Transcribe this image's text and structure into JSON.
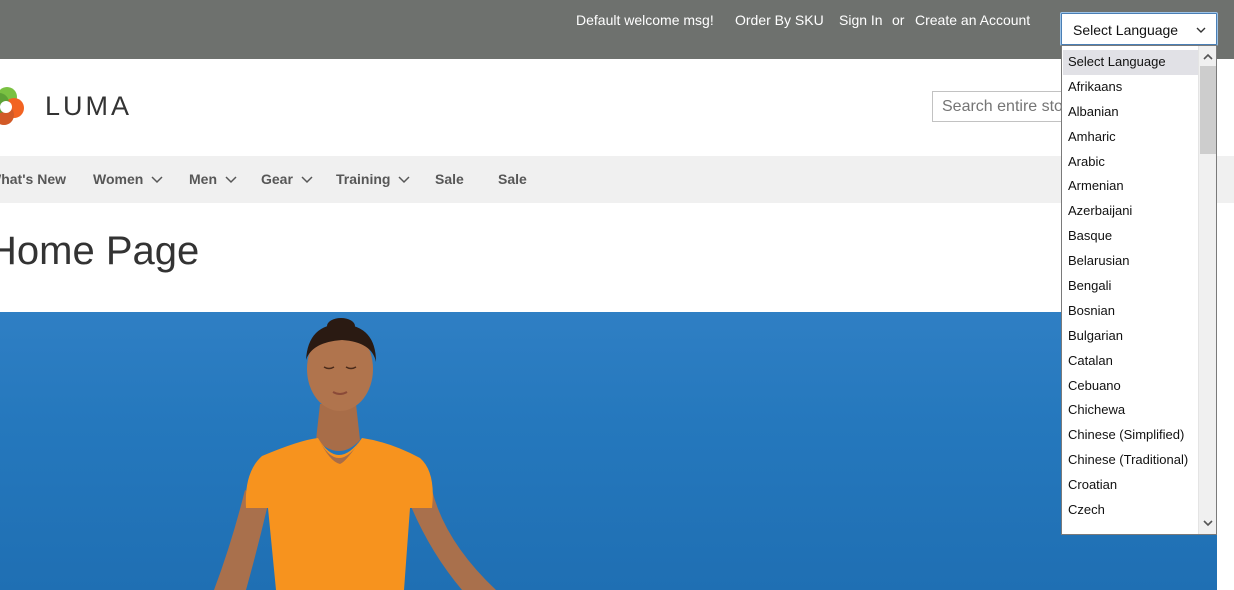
{
  "top_panel": {
    "welcome": "Default welcome msg!",
    "order_by_sku": "Order By SKU",
    "sign_in": "Sign In",
    "or": "or",
    "create_account": "Create an Account",
    "language_selected": "Select Language"
  },
  "header": {
    "logo_text": "LUMA",
    "search_placeholder": "Search entire store here..."
  },
  "nav": {
    "whats_new": "What's New",
    "women": "Women",
    "men": "Men",
    "gear": "Gear",
    "training": "Training",
    "sale_1": "Sale",
    "sale_2": "Sale"
  },
  "page_title": "Home Page",
  "language_dropdown": {
    "options": [
      "Select Language",
      "Afrikaans",
      "Albanian",
      "Amharic",
      "Arabic",
      "Armenian",
      "Azerbaijani",
      "Basque",
      "Belarusian",
      "Bengali",
      "Bosnian",
      "Bulgarian",
      "Catalan",
      "Cebuano",
      "Chichewa",
      "Chinese (Simplified)",
      "Chinese (Traditional)",
      "Croatian",
      "Czech"
    ],
    "selected_index": 0
  },
  "colors": {
    "top_panel_bg": "#6e716e",
    "nav_bg": "#f0f0f0",
    "hero_blue": "#2578bd",
    "shirt_orange": "#f7931e"
  }
}
